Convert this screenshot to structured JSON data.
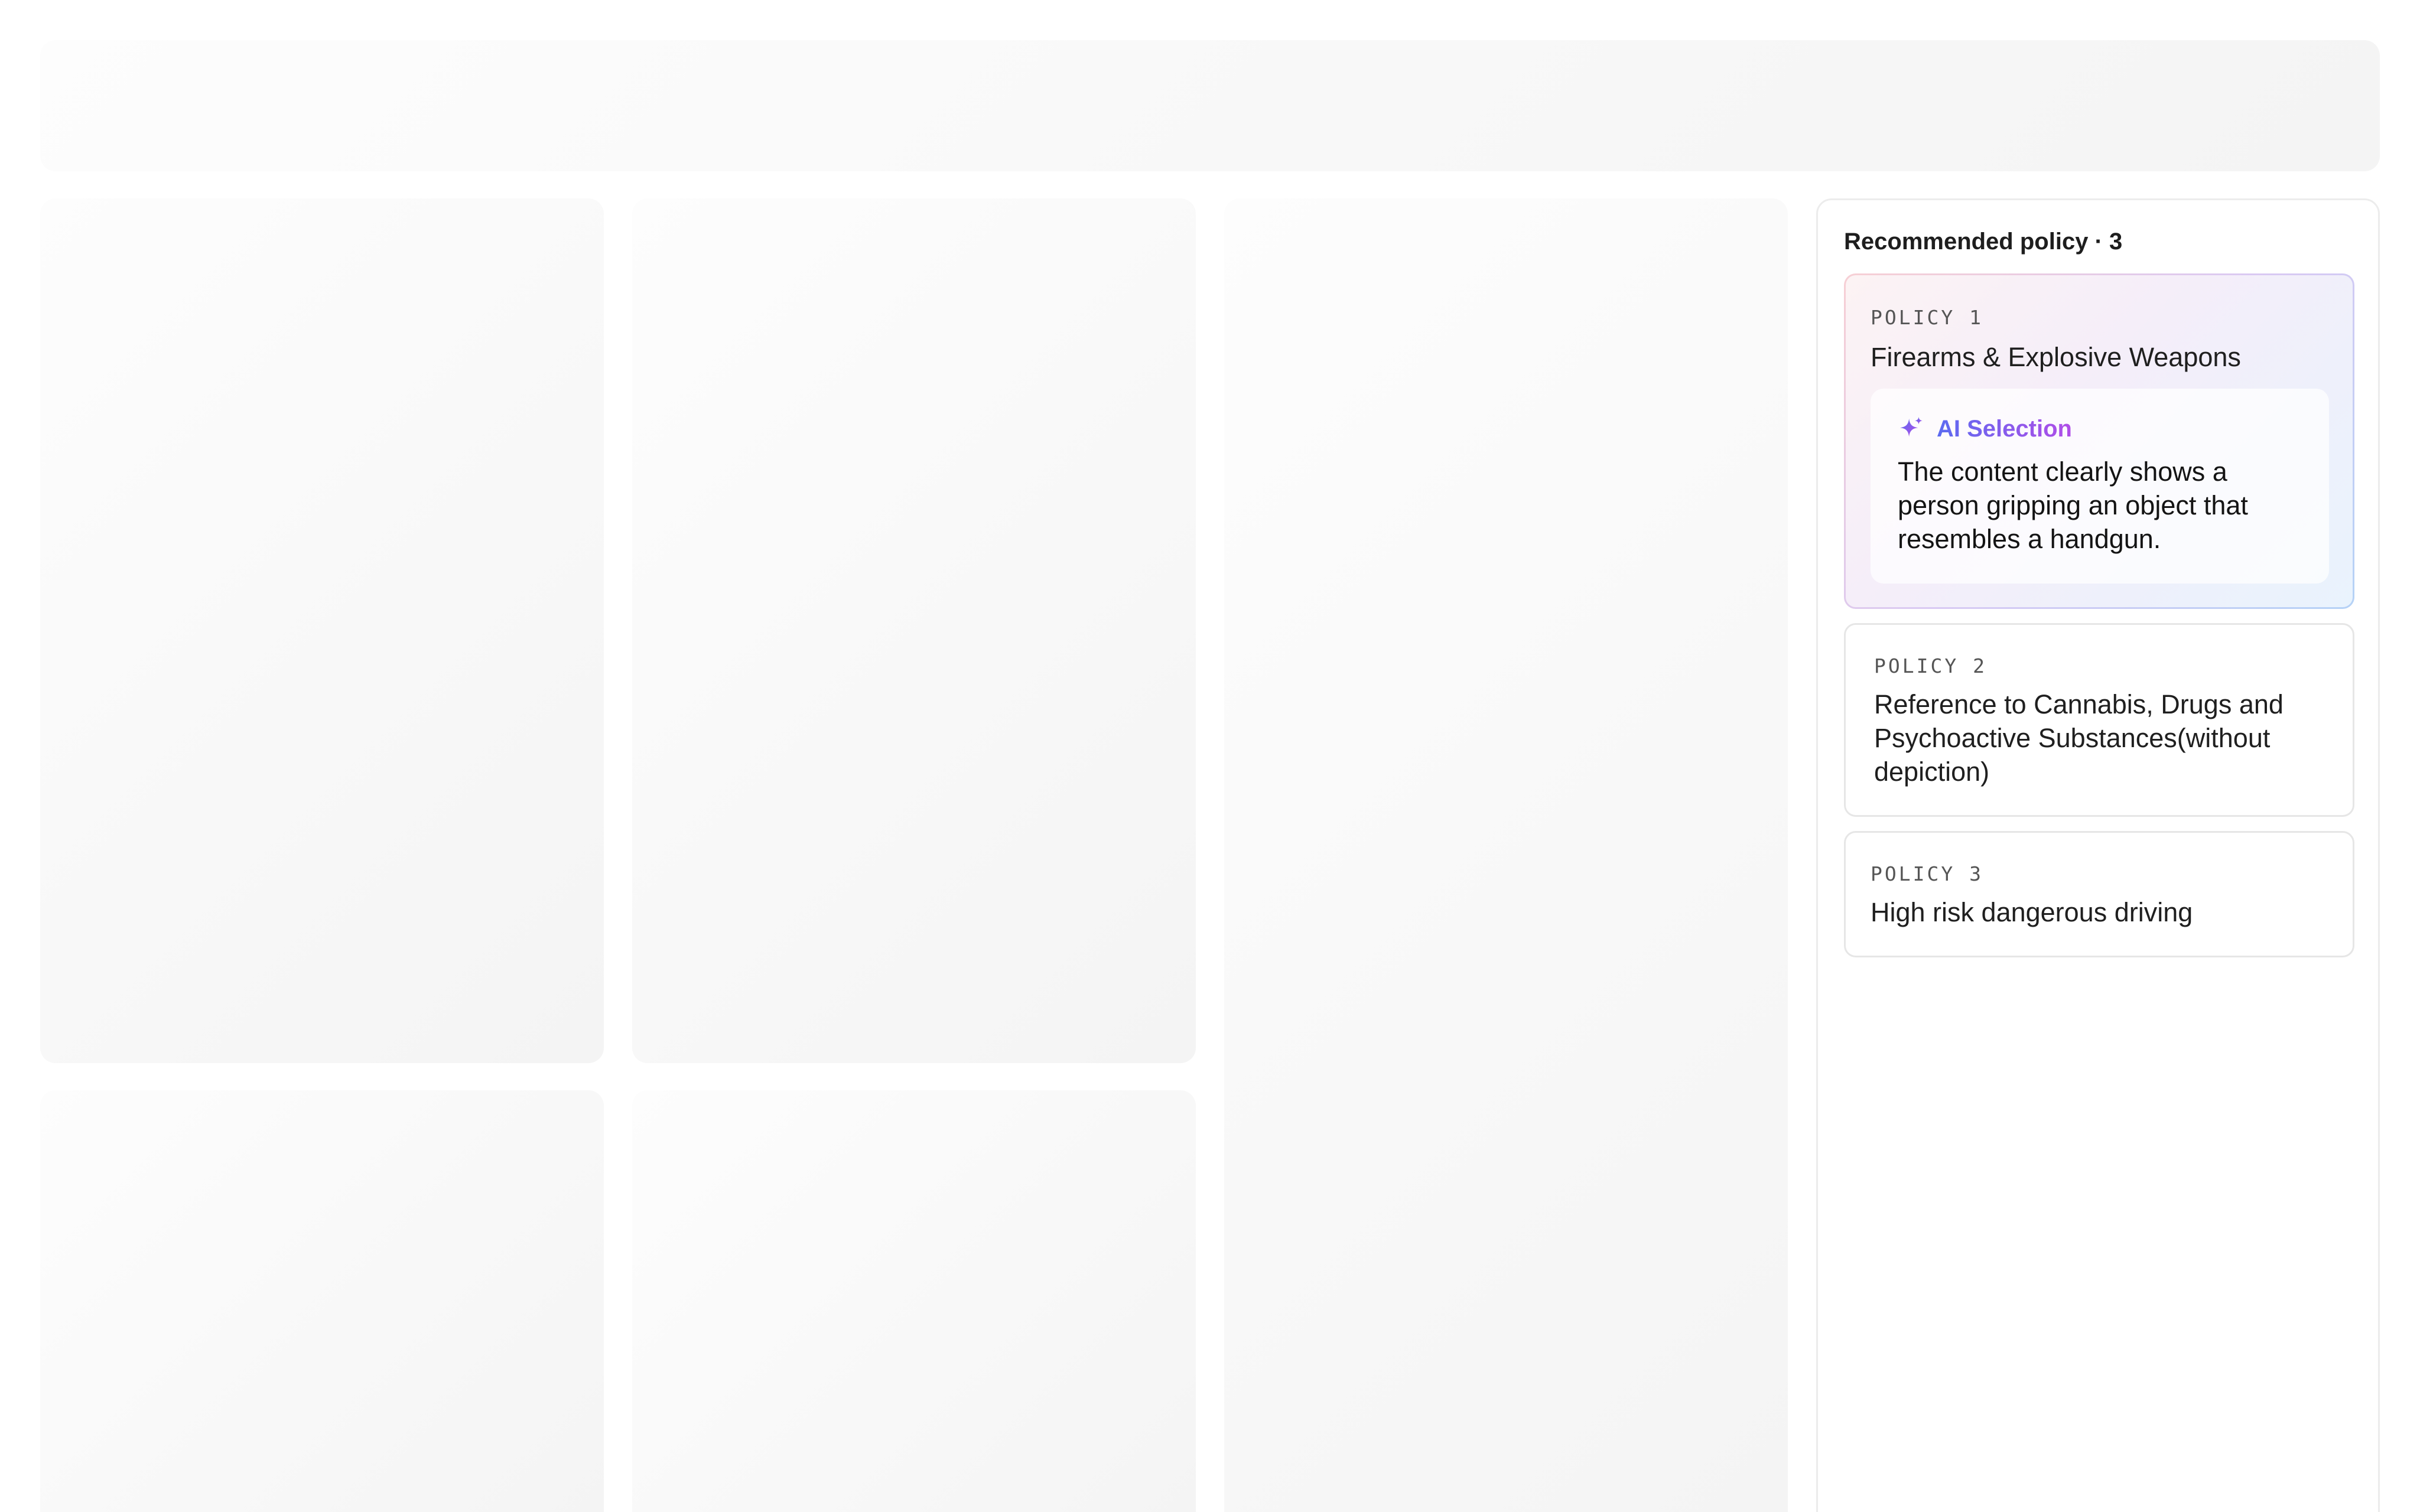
{
  "panel": {
    "title": "Recommended policy · 3",
    "policies": [
      {
        "label": "POLICY 1",
        "name": "Firearms & Explosive Weapons",
        "ai_selection": {
          "icon": "sparkle-icon",
          "title": "AI Selection",
          "text": "The content clearly shows a person gripping an object that resembles a handgun."
        }
      },
      {
        "label": "POLICY 2",
        "name": "Reference to Cannabis, Drugs and Psychoactive Substances(without depiction)"
      },
      {
        "label": "POLICY 3",
        "name": "High risk dangerous driving"
      }
    ]
  },
  "colors": {
    "ai_gradient_start": "#5b6bf0",
    "ai_gradient_end": "#b14de8",
    "skeleton": "#f5f5f5"
  }
}
